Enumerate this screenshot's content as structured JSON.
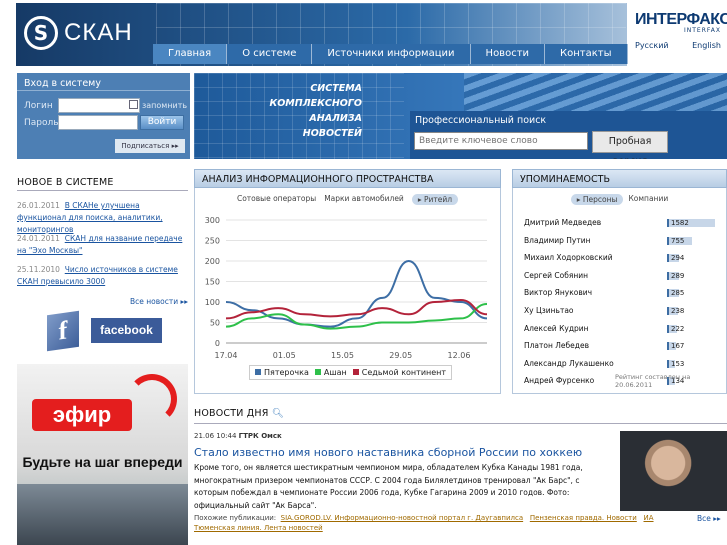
{
  "header": {
    "logo_text": "СКАН",
    "interfax": "ИНТЕРФАКС",
    "interfax_sub": "INTERFAX",
    "lang_ru": "Русский",
    "lang_en": "English",
    "nav": [
      "Главная",
      "О системе",
      "Источники информации",
      "Новости",
      "Контакты"
    ]
  },
  "login": {
    "title": "Вход в систему",
    "login_label": "Логин",
    "password_label": "Пароль",
    "remember": "запомнить",
    "enter": "Войти",
    "subscribe": "Подписаться"
  },
  "banner": {
    "slogan_1": "СИСТЕМА",
    "slogan_2": "КОМПЛЕКСНОГО АНАЛИЗА",
    "slogan_3": "НОВОСТЕЙ",
    "search_label": "Профессиональный поиск",
    "search_placeholder": "Введите ключевое слово",
    "trial": "Пробная версия"
  },
  "new_in_system": {
    "title": "НОВОЕ В СИСТЕМЕ",
    "items": [
      {
        "date": "26.01.2011",
        "text": "В СКАНе улучшена функционал для поиска, аналитики, мониторингов"
      },
      {
        "date": "24.01.2011",
        "text": "СКАН для название передаче на \"Эхо Москвы\""
      },
      {
        "date": "25.11.2010",
        "text": "Число источников в системе СКАН превысило 3000"
      }
    ],
    "all_news": "Все новости"
  },
  "social": {
    "facebook": "facebook"
  },
  "ad": {
    "brand": "эфир",
    "slogan": "Будьте на шаг впереди"
  },
  "analysis": {
    "title": "АНАЛИЗ ИНФОРМАЦИОННОГО ПРОСТРАНСТВА",
    "tabs": [
      "Сотовые операторы",
      "Марки автомобилей",
      "Ритейл"
    ]
  },
  "chart_data": {
    "type": "line",
    "x": [
      "17.04",
      "01.05",
      "15.05",
      "29.05",
      "12.06"
    ],
    "ylim": [
      0,
      300
    ],
    "yticks": [
      0,
      50,
      100,
      150,
      200,
      250,
      300
    ],
    "series": [
      {
        "name": "Пятерочка",
        "color": "#3d6ea5",
        "values": [
          100,
          80,
          60,
          45,
          40,
          60,
          110,
          200,
          110,
          100,
          60
        ]
      },
      {
        "name": "Ашан",
        "color": "#2ec04a",
        "values": [
          40,
          60,
          70,
          45,
          35,
          40,
          50,
          50,
          55,
          60,
          95
        ]
      },
      {
        "name": "Седьмой континент",
        "color": "#b3233a",
        "values": [
          60,
          75,
          85,
          70,
          65,
          70,
          85,
          70,
          100,
          105,
          70
        ]
      }
    ]
  },
  "mentions": {
    "title": "УПОМИНАЕМОСТЬ",
    "tabs": [
      "Персоны",
      "Компании"
    ],
    "rows": [
      {
        "name": "Дмитрий Медведев",
        "value": "1582",
        "frac": 1.0
      },
      {
        "name": "Владимир Путин",
        "value": "755",
        "frac": 0.48
      },
      {
        "name": "Михаил Ходорковский",
        "value": "294",
        "frac": 0.19
      },
      {
        "name": "Сергей Собянин",
        "value": "289",
        "frac": 0.18
      },
      {
        "name": "Виктор Янукович",
        "value": "285",
        "frac": 0.18
      },
      {
        "name": "Ху Цзиньтао",
        "value": "238",
        "frac": 0.15
      },
      {
        "name": "Алексей Кудрин",
        "value": "222",
        "frac": 0.14
      },
      {
        "name": "Платон Лебедев",
        "value": "167",
        "frac": 0.11
      },
      {
        "name": "Александр Лукашенко",
        "value": "153",
        "frac": 0.1
      },
      {
        "name": "Андрей Фурсенко",
        "value": "134",
        "frac": 0.08
      }
    ],
    "rating_note": "Рейтинг составлен на 20.06.2011"
  },
  "news_day": {
    "title": "НОВОСТИ ДНЯ",
    "time": "21.06 10:44",
    "source": "ГТРК Омск",
    "headline": "Стало известно имя нового наставника сборной России по хоккею",
    "body": "Кроме того, он является шестикратным чемпионом мира, обладателем Кубка Канады 1981 года, многократным призером чемпионатов СССР. С 2004 года Билялетдинов тренировал \"Ак Барс\", с которым побеждал в чемпионате России 2006 года, Кубке Гагарина 2009 и 2010 годов. Фото: официальный сайт \"Ак Барса\".",
    "similar_label": "Похожие публикации:",
    "similar": [
      "SIA.GOROD.LV. Информационно-новостной портал г. Даугавпилса",
      "Пензенская правда. Новости",
      "ИА Тюменская линия. Лента новостей"
    ],
    "all": "Все"
  }
}
